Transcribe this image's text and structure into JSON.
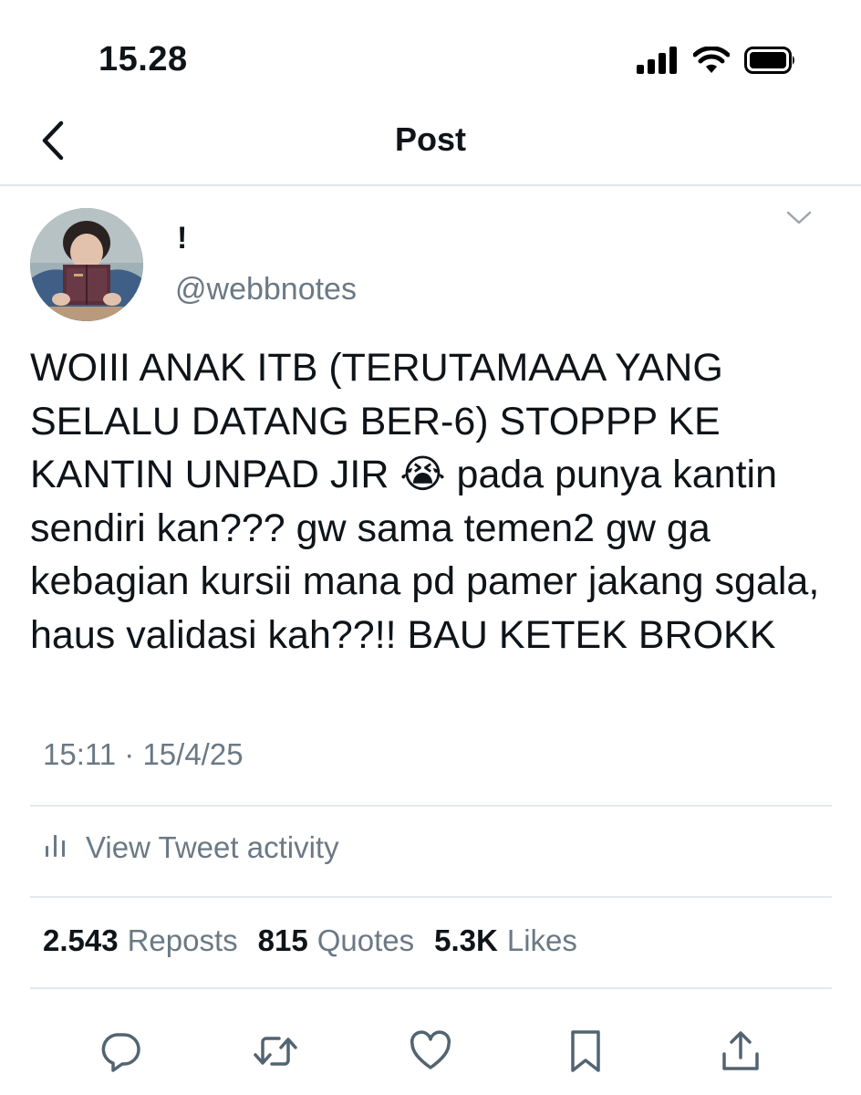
{
  "status_bar": {
    "time": "15.28",
    "icons": [
      "signal-icon",
      "wifi-icon",
      "battery-icon"
    ]
  },
  "nav": {
    "back_icon": "chevron-left-icon",
    "title": "Post"
  },
  "tweet": {
    "display_name": "!",
    "handle": "@webbnotes",
    "text": "WOIII ANAK ITB (TERUTAMAAA YANG SELALU DATANG BER-6) STOPPP KE KANTIN UNPAD JIR 😭 pada punya kantin sendiri kan??? gw sama temen2 gw ga kebagian kursii mana pd pamer jakang sgala, haus validasi kah??!! BAU KETEK BROKK",
    "timestamp": "15:11 · 15/4/25",
    "activity_label": "View Tweet activity",
    "stats": {
      "reposts_count": "2.543",
      "reposts_label": "Reposts",
      "quotes_count": "815",
      "quotes_label": "Quotes",
      "likes_count": "5.3K",
      "likes_label": "Likes"
    },
    "actions": [
      "reply-icon",
      "retweet-icon",
      "like-icon",
      "bookmark-icon",
      "share-icon"
    ]
  },
  "colors": {
    "text": "#0f1419",
    "secondary": "#6b7985",
    "divider": "#e4e8eb"
  }
}
